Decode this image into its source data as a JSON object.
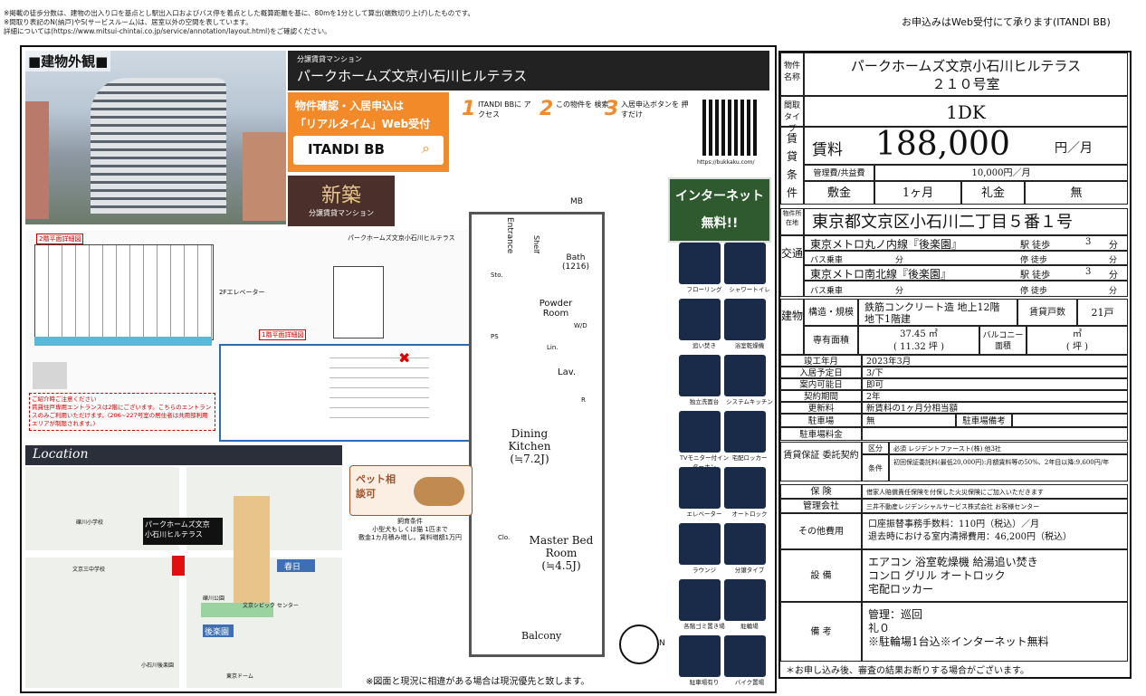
{
  "header": {
    "notes": [
      "※掲載の徒歩分数は、建物の出入り口を基点とし駅出入口およびバス停を着点とした概算距離を基に、80mを1分として算出(端数切り上げ)したものです。",
      "※間取り表記のN(納戸)やS(サービスルーム)は、居室以外の空間を表しています。",
      "詳細については(https://www.mitsui-chintai.co.jp/service/annotation/layout.html)をご確認ください。"
    ],
    "application": "お申込みはWeb受付にて承ります(ITANDI BB)"
  },
  "left": {
    "exterior_title": "■建物外観■",
    "location_title": "Location",
    "floor2_label": "2階平面詳細図",
    "floor1_label": "1階平面詳細図",
    "elevator_label": "2Fエレベーター",
    "notice_title": "ご紹介時ご注意ください",
    "notice_text": "賃貸住戸専用エントランスは2階にございます。こちらのエントランスのみご利用いただけます。(206~227号室の居住者は共用部利用エリアが制限されます。)",
    "map_building": "パークホームズ文京\n小石川ヒルテラス",
    "map_labels": [
      "春日",
      "後楽園",
      "文京シビック センター",
      "礫川公園",
      "小石川後楽園",
      "東京ドーム",
      "文京三中学校",
      "礫川小学校"
    ]
  },
  "promo": {
    "subtitle": "分譲賃貸マンション",
    "name": "パークホームズ文京小石川ヒルテラス",
    "itandi_title": "物件確認・入居申込は",
    "itandi_sub": "「リアルタイム」Web受付",
    "itandi_logo": "ITANDI BB",
    "steps": [
      "ITANDI BBに アクセス",
      "この物件を 検索",
      "入居申込ボタンを 押すだけ"
    ],
    "qr_url": "https://bukkaku.com/",
    "new_badge": "新築",
    "new_sub": "分譲賃貸マンション",
    "internet_badge": "インターネット無料!!",
    "pet": "ペット相談可",
    "pet_note": "飼育条件\n小型犬もしくは猫 1匹まで\n敷金1カ月積み増し。賃料増額1万円",
    "disclaimer": "※図面と現況に相違がある場合は現況優先と致します。"
  },
  "floorplan": {
    "rooms": [
      "Entrance",
      "Shelf",
      "Bath (1216)",
      "Powder Room",
      "Lav.",
      "Dining Kitchen (≒7.2J)",
      "Master Bed Room (≒4.5J)",
      "Balcony",
      "MB"
    ],
    "marks": [
      "S.C",
      "Sto.",
      "PS",
      "W/D",
      "Lin.",
      "R",
      "Clo."
    ]
  },
  "amenities": [
    "フローリング",
    "シャワートイレ",
    "追い焚き",
    "浴室乾燥機",
    "独立洗面台",
    "システムキッチン",
    "TVモニター付インターホン",
    "宅配ロッカー",
    "エレベーター",
    "オートロック",
    "ラウンジ",
    "分譲タイプ",
    "各階ゴミ置き場",
    "駐輪場",
    "駐車場有り",
    "バイク置場"
  ],
  "info": {
    "name_label": "物件名称",
    "name": "パークホームズ文京小石川ヒルテラス",
    "room": "２１０号室",
    "layout_label": "間取タイプ",
    "layout": "1DK",
    "rent_label_chars": [
      "賃",
      "貸",
      "条",
      "件"
    ],
    "rent_label": "賃料",
    "rent": "188,000",
    "rent_unit": "円／月",
    "mgmt_label": "管理費/共益費",
    "mgmt": "10,000円／月",
    "deposit_label": "敷金",
    "deposit": "1ヶ月",
    "key_money_label": "礼金",
    "key_money": "無",
    "address_label": "物件所在地",
    "address": "東京都文京区小石川二丁目５番１号",
    "transport_label": "交通",
    "lines": [
      {
        "line": "東京メトロ丸ノ内線『後楽園』",
        "walk": "駅 徒歩",
        "min": "3",
        "unit": "分"
      },
      {
        "line": "東京メトロ南北線『後楽園』",
        "walk": "駅 徒歩",
        "min": "3",
        "unit": "分"
      }
    ],
    "bus_label": "バス乗車",
    "bus_unit": "分",
    "bus_stop": "停 徒歩",
    "building_label": "建物",
    "structure_label": "構造・規模",
    "structure": "鉄筋コンクリート造 地上12階 地下1階建",
    "units_label": "賃貸戸数",
    "units": "21戸",
    "area_label": "専有面積",
    "area": "37.45 ㎡",
    "area_tsubo": "( 11.32 坪 )",
    "balcony_label": "バルコニー面積",
    "balcony": "㎡",
    "balcony_tsubo": "( 坪 )",
    "rows": [
      {
        "k": "竣工年月",
        "v": "2023年3月"
      },
      {
        "k": "入居予定日",
        "v": "3/下"
      },
      {
        "k": "案内可能日",
        "v": "即可"
      },
      {
        "k": "契約期間",
        "v": "2年"
      },
      {
        "k": "更新料",
        "v": "新賃料の1ヶ月分相当額"
      }
    ],
    "parking_label": "駐車場",
    "parking": "無",
    "parking_note_label": "駐車場備考",
    "parking_fee_label": "駐車場料金",
    "guarantee_label": "賃貸保証 委託契約",
    "guarantee_type_label": "区分",
    "guarantee_type": "必須 レジデントファースト(株) 他3社",
    "guarantee_cond_label": "条件",
    "guarantee_cond": "初回保証委託料(最低20,000円):月額賃料等の50%、2年目以降:9,600円/年",
    "insurance_label": "保 険",
    "insurance": "借家人賠償責任保険を付保した火災保険にご加入いただきます",
    "mgmt_co_label": "管理会社",
    "mgmt_co": "三井不動産レジデンシャルサービス株式会社 お客様センター",
    "other_label": "その他費用",
    "other": [
      "口座振替事務手数料：110円（税込）／月",
      "退去時における室内清掃費用：46,200円（税込）"
    ],
    "equip_label": "設 備",
    "equip": [
      "エアコン 浴室乾燥機 給湯追い焚き",
      "コンロ グリル オートロック",
      "宅配ロッカー"
    ],
    "remarks_label": "備 考",
    "remarks": [
      "管理：巡回",
      "礼０",
      "※駐輪場1台込※インターネット無料"
    ],
    "footnote": "＊お申し込み後、審査の結果お断りする場合がございます。"
  }
}
